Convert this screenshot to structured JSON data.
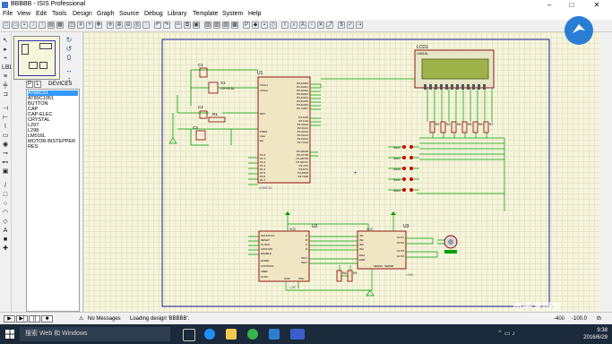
{
  "window": {
    "title": "BBBBB - ISIS Professional",
    "controls": [
      "–",
      "□",
      "✕"
    ]
  },
  "menu": [
    "File",
    "View",
    "Edit",
    "Tools",
    "Design",
    "Graph",
    "Source",
    "Debug",
    "Library",
    "Template",
    "System",
    "Help"
  ],
  "side_panel": {
    "tab_p": "P",
    "tab_l": "L",
    "devices_label": "DEVICES",
    "devices": [
      "AT89C51",
      "AT89C1051",
      "BUTTON",
      "CAP",
      "CAP-ELEC",
      "CRYSTAL",
      "L297",
      "L298",
      "LM016L",
      "MOTOR-BISTEPPER",
      "RES"
    ],
    "selected_index": 0
  },
  "schematic": {
    "components": {
      "u1": "U1",
      "u1_part": "AT89C51",
      "u2": "U2",
      "u2_part": "L297",
      "u3": "U3",
      "u3_part": "L298",
      "lcd": "LCD1",
      "lcd_part": "LM016L",
      "x1": "X1",
      "x1_value": "CRYSTAL",
      "c1": "C1",
      "c2": "C2",
      "c3": "C3",
      "r1": "R1",
      "r2": "R2",
      "r3": "R3",
      "r4": "R4",
      "r5": "R5",
      "r6": "R6",
      "r7": "R7",
      "r8": "R8",
      "r9": "R9"
    },
    "u1_left_pins": [
      "XTAL1",
      "XTAL2",
      "RST",
      "PSEN",
      "ALE",
      "EA",
      "P1.0",
      "P1.1",
      "P1.2",
      "P1.3",
      "P1.4",
      "P1.5",
      "P1.6",
      "P1.7"
    ],
    "u1_right_pins": [
      "P0.0/AD0",
      "P0.1/AD1",
      "P0.2/AD2",
      "P0.3/AD3",
      "P0.4/AD4",
      "P0.5/AD5",
      "P0.6/AD6",
      "P0.7/AD7",
      "P2.0/A8",
      "P2.1/A9",
      "P2.2/A10",
      "P2.3/A11",
      "P2.4/A12",
      "P2.5/A13",
      "P2.6/A14",
      "P2.7/A15",
      "P3.0/RXD",
      "P3.1/TXD",
      "P3.2/INT0",
      "P3.3/INT1",
      "P3.4/T0",
      "P3.5/T1",
      "P3.6/WR",
      "P3.7/RD"
    ],
    "u2_left_pins": [
      "HALF/FULL",
      "RESET",
      "CLOCK",
      "CW/CCW",
      "ENABLE",
      "HOME",
      "CONTROL",
      "VREF",
      "SYNC"
    ],
    "u2_right_pins": [
      "A",
      "B",
      "C",
      "D",
      "INH1",
      "INH2"
    ],
    "u2_bottom_pins": [
      "GND",
      "OSC",
      "SENS1",
      "SENS2"
    ],
    "u3_left_pins": [
      "IN1",
      "IN2",
      "IN3",
      "IN4",
      "ENA",
      "ENB"
    ],
    "u3_right_pins": [
      "OUT1",
      "OUT2",
      "OUT3",
      "OUT4"
    ],
    "u3_bottom_pins": [
      "SENSA",
      "SENSB",
      "GND"
    ],
    "button_labels": [
      "SW1",
      "SW2",
      "SW3",
      "SW4",
      "SW5"
    ],
    "supply": "VCC"
  },
  "status": {
    "messages": "No Messages",
    "loading": "Loading design 'BBBBB'.",
    "coord_x": "-400",
    "coord_y": "-100.0",
    "units": "th"
  },
  "taskbar": {
    "search_placeholder": "搜索 Web 和 Windows",
    "time": "9:38",
    "date": "2016/6/29"
  },
  "watermark": {
    "text": "电子发烧友",
    "url": "www.elecfans.com"
  },
  "colors": {
    "canvas": "#f5f5dc",
    "wire": "#00a000",
    "component_outline": "#8b0000",
    "selected": "#3399ff",
    "taskbar": "#1b2a3a"
  }
}
